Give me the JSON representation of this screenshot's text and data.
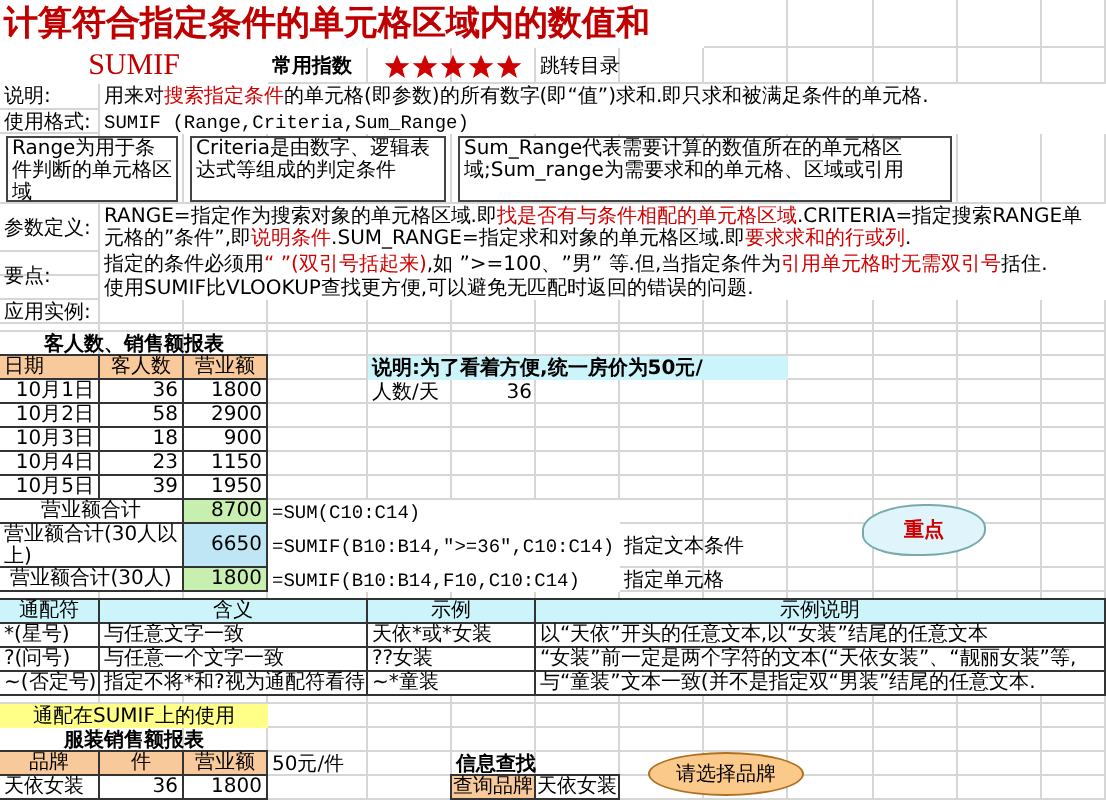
{
  "title": "计算符合指定条件的单元格区域内的数值和",
  "function_name": "SUMIF",
  "frequency": {
    "label": "常用指数",
    "stars": 5
  },
  "jump_link": "跳转目录",
  "description": {
    "label": "说明:",
    "segments": [
      {
        "text": "用来对",
        "highlight": false
      },
      {
        "text": "搜索指定条件",
        "highlight": true
      },
      {
        "text": "的单元格(即参数)的所有数字(即“值”)求和.即只求和被满足条件的单元格.",
        "highlight": false
      }
    ]
  },
  "syntax": {
    "label": "使用格式:",
    "text": "SUMIF (Range,Criteria,Sum_Range)"
  },
  "callouts": [
    "Range为用于条件判断的单元格区域",
    "Criteria是由数字、逻辑表达式等组成的判定条件",
    "Sum_Range代表需要计算的数值所在的单元格区域;Sum_range为需要求和的单元格、区域或引用"
  ],
  "parameters": {
    "label": "参数定义:",
    "segments": [
      {
        "text": "RANGE=指定作为搜索对象的单元格区域.即",
        "highlight": false
      },
      {
        "text": "找是否有与条件相配的单元格区域",
        "highlight": true
      },
      {
        "text": ".CRITERIA=指定搜索RANGE单元格的”条件”,即",
        "highlight": false
      },
      {
        "text": "说明条件",
        "highlight": true
      },
      {
        "text": ".SUM_RANGE=指定求和对象的单元格区域.即",
        "highlight": false
      },
      {
        "text": "要求求和的行或列",
        "highlight": true
      },
      {
        "text": ".",
        "highlight": false
      }
    ]
  },
  "key_points": {
    "label": "要点:",
    "lines": [
      {
        "segments": [
          {
            "text": "指定的条件必须用",
            "highlight": false
          },
          {
            "text": "“ ”(双引号括起来)",
            "highlight": true
          },
          {
            "text": ",如 ”>=100、”男” 等.但,当指定条件为",
            "highlight": false
          },
          {
            "text": "引用单元格时无需双引号",
            "highlight": true
          },
          {
            "text": "括住.",
            "highlight": false
          }
        ]
      },
      {
        "segments": [
          {
            "text": "使用SUMIF比VLOOKUP查找更方便,可以避免无匹配时返回的错误的问题.",
            "highlight": false
          }
        ]
      }
    ]
  },
  "example_label": "应用实例:",
  "report1": {
    "title": "客人数、销售额报表",
    "columns": [
      "日期",
      "客人数",
      "营业额"
    ],
    "rows": [
      [
        "10月1日",
        "36",
        "1800"
      ],
      [
        "10月2日",
        "58",
        "2900"
      ],
      [
        "10月3日",
        "18",
        "900"
      ],
      [
        "10月4日",
        "23",
        "1150"
      ],
      [
        "10月5日",
        "39",
        "1950"
      ]
    ],
    "totals": [
      {
        "label": "营业额合计",
        "value": "8700",
        "color": "#c6efb0",
        "formula": "=SUM(C10:C14)"
      },
      {
        "label": "营业额合计(30人以上)",
        "value": "6650",
        "color": "#bfe6f5",
        "formula": "=SUMIF(B10:B14,\">=36\",C10:C14)",
        "note": "指定文本条件"
      },
      {
        "label": "营业额合计(30人)",
        "value": "1800",
        "color": "#c6efb0",
        "formula": "=SUMIF(B10:B14,F10,C10:C14)",
        "note": "指定单元格"
      }
    ]
  },
  "side_note": {
    "text": "说明:为了看着方便,统一房价为50元/",
    "label": "人数/天",
    "value": "36"
  },
  "cloud": "重点",
  "wildcards": {
    "columns": [
      "通配符",
      "含义",
      "示例",
      "示例说明"
    ],
    "rows": [
      [
        "*(星号)",
        "与任意文字一致",
        "天依*或*女装",
        "以“天依”开头的任意文本,以“女装”结尾的任意文本"
      ],
      [
        "?(问号)",
        "与任意一个文字一致",
        "??女装",
        "“女装”前一定是两个字符的文本(“天依女装”、“靓丽女装”等,"
      ],
      [
        "~(否定号)",
        "指定不将*和?视为通配符看待",
        "~*童装",
        "与“童装”文本一致(并不是指定双“男装”结尾的任意文本."
      ]
    ]
  },
  "section2_label": "通配在SUMIF上的使用",
  "report2": {
    "title": "服装销售额报表",
    "columns": [
      "品牌",
      "件",
      "营业额"
    ],
    "price": "50元/件",
    "rows": [
      [
        "天依女装",
        "36",
        "1800"
      ]
    ]
  },
  "lookup": {
    "title": "信息查找",
    "label": "查询品牌",
    "value": "天依女装"
  },
  "bubble": "请选择品牌"
}
